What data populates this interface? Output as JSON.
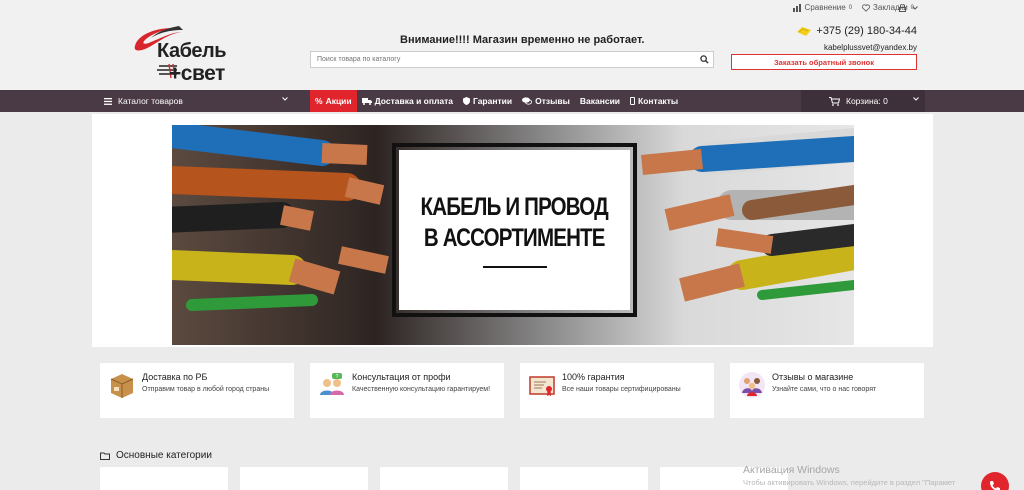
{
  "header": {
    "logo": {
      "line1": "Кабель",
      "line2": "+свет"
    },
    "notice": "Внимание!!!! Магазин временно не работает.",
    "search_placeholder": "Поиск товара по каталогу",
    "top_links": [
      {
        "label": "Сравнение",
        "count": "0",
        "icon": "chart-icon"
      },
      {
        "label": "Закладки",
        "count": "0",
        "icon": "heart-icon"
      }
    ],
    "phone": "+375 (29) 180-34-44",
    "email": "kabelplussvet@yandex.by",
    "callback_label": "Заказать обратный звонок"
  },
  "nav": {
    "catalog_label": "Каталог товаров",
    "items": [
      {
        "label": "Акции",
        "icon": "percent-icon",
        "active": true
      },
      {
        "label": "Доставка и оплата",
        "icon": "truck-icon"
      },
      {
        "label": "Гарантии",
        "icon": "shield-icon"
      },
      {
        "label": "Отзывы",
        "icon": "comments-icon"
      },
      {
        "label": "Вакансии",
        "icon": ""
      },
      {
        "label": "Контакты",
        "icon": "phone-icon"
      }
    ],
    "cart_label": "Корзина: 0"
  },
  "banner": {
    "line1": "КАБЕЛЬ И ПРОВОД",
    "line2": "В АССОРТИМЕНТЕ"
  },
  "features": [
    {
      "title": "Доставка по РБ",
      "desc": "Отправим товар в любой город страны",
      "icon": "box-icon"
    },
    {
      "title": "Консультация от профи",
      "desc": "Качественную консультацию гарантируем!",
      "icon": "consultants-icon"
    },
    {
      "title": "100% гарантия",
      "desc": "Все наши товары сертифицированы",
      "icon": "certificate-icon"
    },
    {
      "title": "Отзывы о магазине",
      "desc": "Узнайте сами, что о нас говорят",
      "icon": "people-icon"
    }
  ],
  "categories_title": "Основные категории",
  "watermark": {
    "title": "Активация Windows",
    "subtitle": "Чтобы активировать Windows, перейдите в раздел \"Парамет"
  },
  "colors": {
    "nav_bg": "#4a3a45",
    "accent": "#e0262c"
  }
}
